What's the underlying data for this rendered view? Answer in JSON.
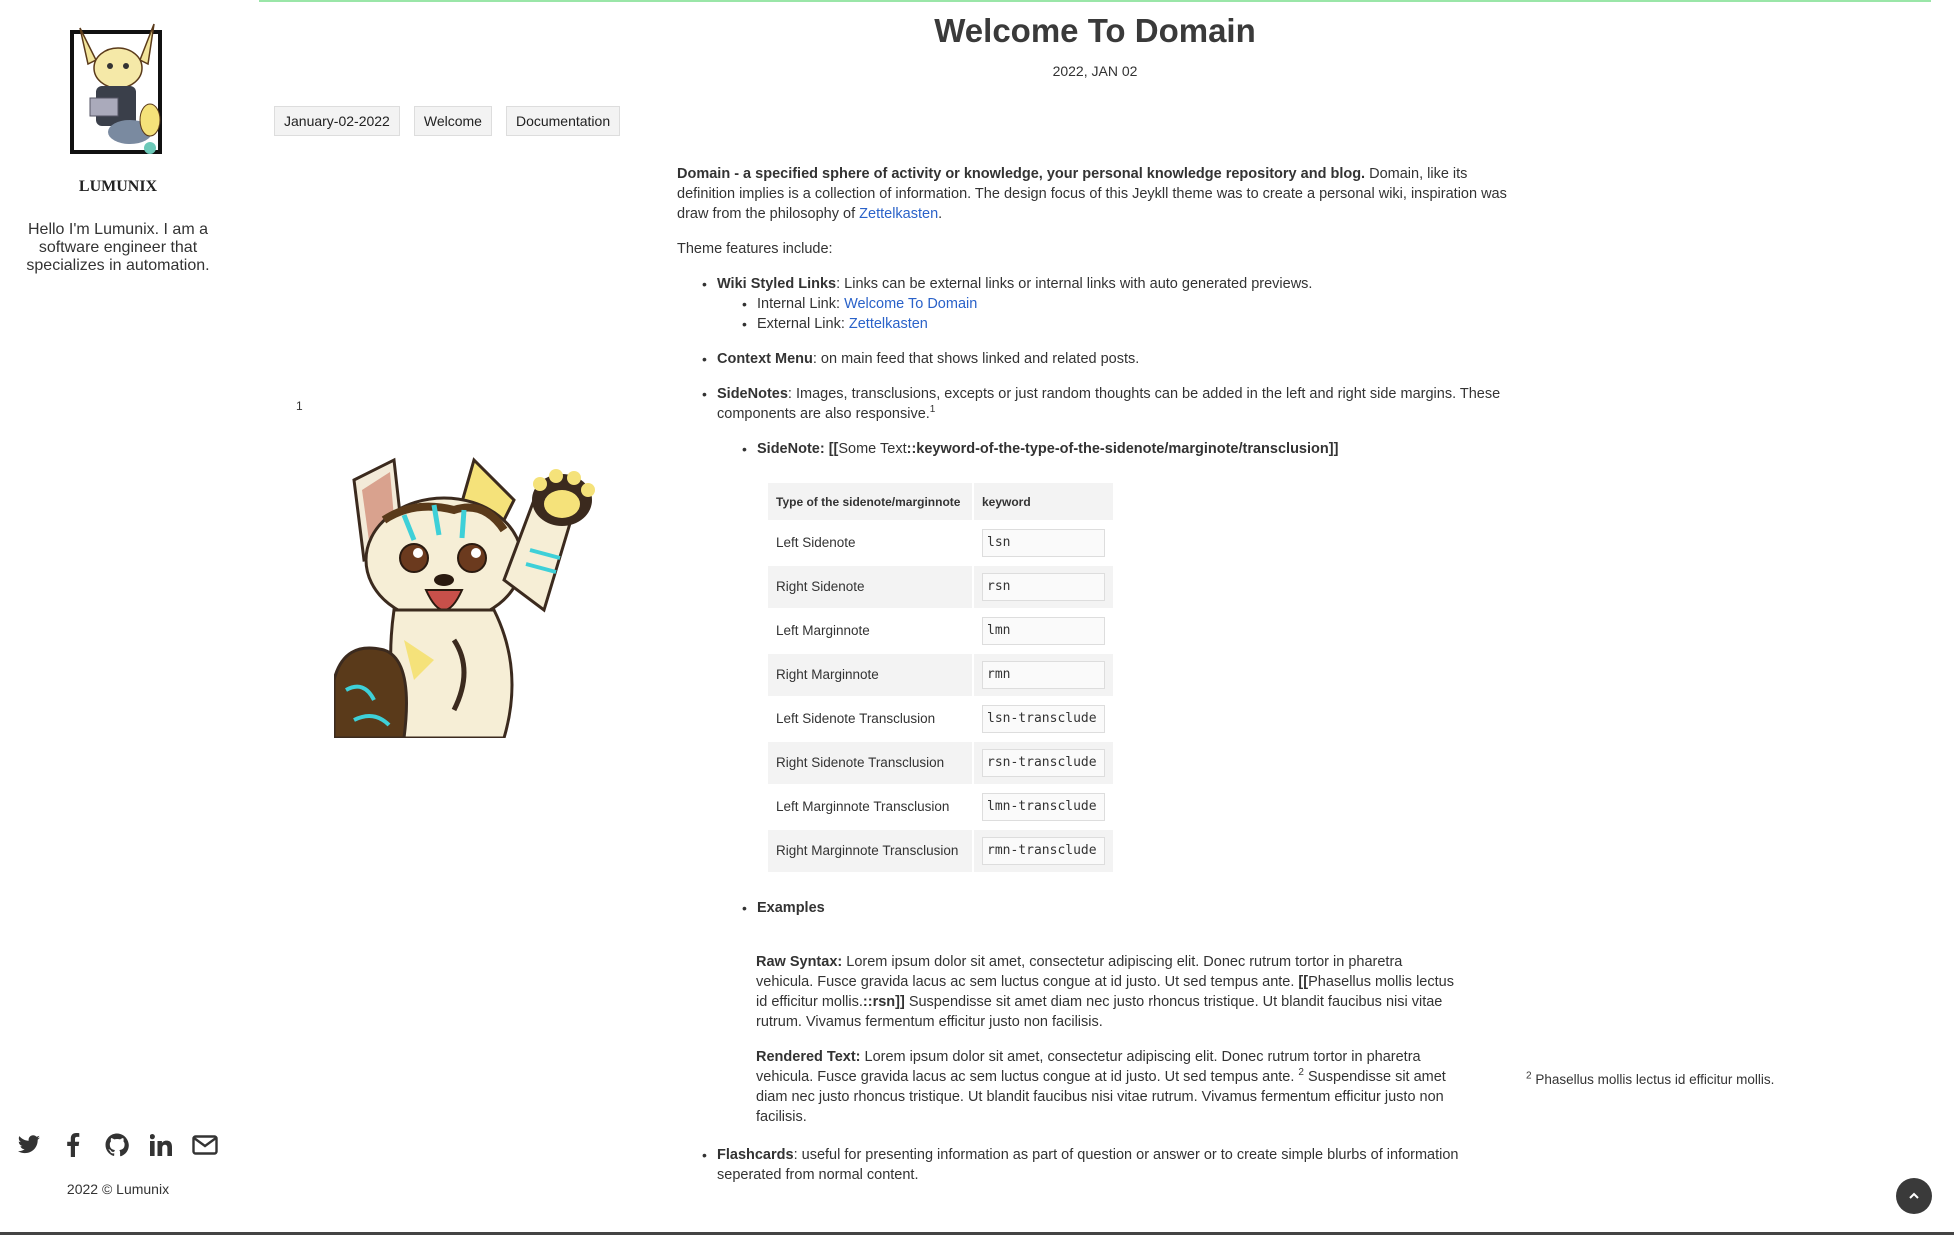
{
  "sidebar": {
    "site_name": "LUMUNIX",
    "bio": "Hello I'm Lumunix. I am a software engineer that specializes in automation.",
    "social_icons": [
      "twitter-icon",
      "facebook-icon",
      "github-icon",
      "linkedin-icon",
      "mail-icon"
    ],
    "copyright": "2022 © Lumunix"
  },
  "post": {
    "title": "Welcome To Domain",
    "date": "2022, JAN 02",
    "tags": [
      "January-02-2022",
      "Welcome",
      "Documentation"
    ]
  },
  "content": {
    "intro_bold": "Domain - a specified sphere of activity or knowledge, your personal knowledge repository and blog.",
    "intro_text": " Domain, like its definition implies is a collection of information. The design focus of this Jeykll theme was to create a personal wiki, inspiration was draw from the philosophy of ",
    "intro_link": "Zettelkasten",
    "features_label": "Theme features include:",
    "wiki_title": "Wiki Styled Links",
    "wiki_text": ": Links can be external links or internal links with auto generated previews.",
    "internal_label": "Internal Link: ",
    "internal_link": "Welcome To Domain",
    "external_label": "External Link: ",
    "external_link": "Zettelkasten",
    "context_title": "Context Menu",
    "context_text": ": on main feed that shows linked and related posts.",
    "sidenotes_title": "SideNotes",
    "sidenotes_text": ": Images, transclusions, excepts or just random thoughts can be added in the left and right side margins. These components are also responsive.",
    "sidenotes_sup": "1",
    "sidenote_syntax_label": "SideNote: [[",
    "sidenote_syntax_plain": "Some Text",
    "sidenote_syntax_end": "::keyword-of-the-type-of-the-sidenote/marginote/transclusion]]",
    "table": {
      "headers": [
        "Type of the sidenote/marginnote",
        "keyword"
      ],
      "rows": [
        [
          "Left Sidenote",
          "lsn"
        ],
        [
          "Right Sidenote",
          "rsn"
        ],
        [
          "Left Marginnote",
          "lmn"
        ],
        [
          "Right Marginnote",
          "rmn"
        ],
        [
          "Left Sidenote Transclusion",
          "lsn-transclude"
        ],
        [
          "Right Sidenote Transclusion",
          "rsn-transclude"
        ],
        [
          "Left Marginnote Transclusion",
          "lmn-transclude"
        ],
        [
          "Right Marginnote Transclusion",
          "rmn-transclude"
        ]
      ]
    },
    "examples_title": "Examples",
    "raw_label": "Raw Syntax:",
    "raw_text_1": " Lorem ipsum dolor sit amet, consectetur adipiscing elit. Donec rutrum tortor in pharetra vehicula. Fusce gravida lacus ac sem luctus congue at id justo. Ut sed tempus ante. ",
    "raw_bold_1": "[[",
    "raw_mid": "Phasellus mollis lectus id efficitur mollis.",
    "raw_bold_2": "::rsn]]",
    "raw_text_2": " Suspendisse sit amet diam nec justo rhoncus tristique. Ut blandit faucibus nisi vitae rutrum. Vivamus fermentum efficitur justo non facilisis.",
    "rendered_label": "Rendered Text:",
    "rendered_text_1": " Lorem ipsum dolor sit amet, consectetur adipiscing elit. Donec rutrum tortor in pharetra vehicula. Fusce gravida lacus ac sem luctus congue at id justo. Ut sed tempus ante. ",
    "rendered_sup": "2",
    "rendered_text_2": " Suspendisse sit amet diam nec justo rhoncus tristique. Ut blandit faucibus nisi vitae rutrum. Vivamus fermentum efficitur justo non facilisis.",
    "flashcards_title": "Flashcards",
    "flashcards_text": ": useful for presenting information as part of question or answer or to create simple blurbs of information seperated from normal content."
  },
  "notes": {
    "left_number": "1",
    "right_number": "2",
    "right_text": "Phasellus mollis lectus id efficitur mollis."
  }
}
